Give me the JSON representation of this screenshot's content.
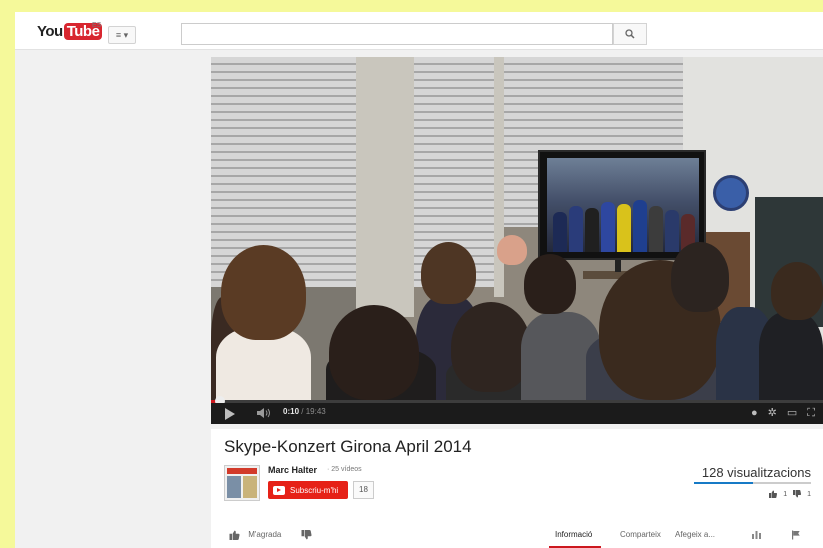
{
  "header": {
    "logo_text_you": "You",
    "logo_text_tube": "Tube",
    "logo_region": "ES",
    "guide_button_label": "≡ ▾",
    "search_placeholder": ""
  },
  "player": {
    "current_time": "0:10",
    "total_time": "/ 19:43",
    "progress_fraction": 0.009
  },
  "video": {
    "title": "Skype-Konzert Girona April 2014",
    "channel_name": "Marc Halter",
    "video_count": "· 25 vídeos",
    "subscribe_label": "Subscriu-m'hi",
    "subscriber_count": "18",
    "views": "128 visualitzacions",
    "like_count": "1",
    "dislike_count": "1",
    "like_ratio": 0.5
  },
  "actions": {
    "like_label": "M'agrada",
    "tabs": [
      "Informació",
      "Comparteix",
      "Afegeix a..."
    ],
    "active_tab": "Informació"
  },
  "colors": {
    "accent_red": "#cc181e",
    "subscribe_red": "#e62117",
    "link_blue": "#167ac6",
    "background_yellow": "#f5f99a"
  },
  "icons": {
    "search": "search-icon",
    "play": "play-icon",
    "volume": "volume-icon",
    "settings": "gear-icon",
    "flag": "flag-icon",
    "stats": "stats-icon"
  }
}
